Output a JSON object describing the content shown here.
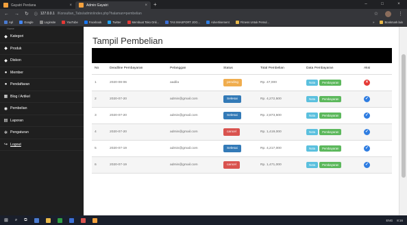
{
  "browser": {
    "tabs": [
      {
        "title": "Gayatri Perdana",
        "active": false,
        "color": "#f4a13d"
      },
      {
        "title": "Admin Gayatri",
        "active": true,
        "color": "#f4a13d"
      }
    ],
    "new_tab": "+",
    "window_controls": {
      "minimize": "–",
      "maximize": "□",
      "close": "×"
    },
    "url_host": "127.0.0.1",
    "url_path": "/Konsultan_Tabs/admin/index.php?halaman=pembelian",
    "bookmarks": [
      "Apl",
      "Google",
      "Loginsite",
      "YouTube",
      "Facebook",
      "Twitter",
      "Membuat Toko Onli...",
      "TAS IMASPORT JOG...",
      "Advertisement",
      "Fitness Untuk Pemul..."
    ],
    "bookmarks_right": [
      "»",
      "Bookmark lain"
    ]
  },
  "sidebar": {
    "top_cut": "Home",
    "items": [
      {
        "label": "Kategori",
        "icon": "tag-icon",
        "glyph": "◆"
      },
      {
        "label": "Produk",
        "icon": "tag-icon",
        "glyph": "◆"
      },
      {
        "label": "Diskon",
        "icon": "tag-icon",
        "glyph": "◆"
      },
      {
        "label": "Member",
        "icon": "user-icon",
        "glyph": "●"
      },
      {
        "label": "Pendaftaran",
        "icon": "user-icon",
        "glyph": "●"
      },
      {
        "label": "Blog / Artikel",
        "icon": "blog-icon",
        "glyph": "▦"
      },
      {
        "label": "Pembelian",
        "icon": "globe-icon",
        "glyph": "◉"
      },
      {
        "label": "Laporan",
        "icon": "print-icon",
        "glyph": "▤"
      },
      {
        "label": "Pengaturan",
        "icon": "gear-icon",
        "glyph": "✲"
      },
      {
        "label": "Logout",
        "icon": "logout-icon",
        "glyph": "↪"
      }
    ]
  },
  "page": {
    "title": "Tampil Pembelian",
    "columns": [
      "No",
      "Deadline Pembayaran",
      "Pelanggan",
      "Status",
      "Total Pembelian",
      "Data Pembayaran",
      "Aksi"
    ],
    "nota_label": "Nota",
    "pembayaran_label": "Pembayaran",
    "rows": [
      {
        "no": "1",
        "deadline": "2020-08-06",
        "pelanggan": "aadila",
        "status": "pending",
        "total": "Rp. 47,000",
        "aksi": "delete"
      },
      {
        "no": "2",
        "deadline": "2020-07-20",
        "pelanggan": "admin@gmail.com",
        "status": "Selesai",
        "total": "Rp. 4,272,500",
        "aksi": "done"
      },
      {
        "no": "3",
        "deadline": "2020-07-20",
        "pelanggan": "admin@gmail.com",
        "status": "Selesai",
        "total": "Rp. 2,873,500",
        "aksi": "done"
      },
      {
        "no": "4",
        "deadline": "2020-07-20",
        "pelanggan": "admin@gmail.com",
        "status": "cancel",
        "total": "Rp. 1,419,000",
        "aksi": "done"
      },
      {
        "no": "5",
        "deadline": "2020-07-19",
        "pelanggan": "admin@gmail.com",
        "status": "Selesai",
        "total": "Rp. 4,217,000",
        "aksi": "done"
      },
      {
        "no": "6",
        "deadline": "2020-07-19",
        "pelanggan": "admin@gmail.com",
        "status": "cancel",
        "total": "Rp. 1,471,000",
        "aksi": "done"
      }
    ]
  },
  "taskbar": {
    "time": "8:16",
    "lang": "ENG"
  },
  "colors": {
    "sidebar_bg": "#1f1f1f",
    "pending": "#f0ad4e",
    "selesai": "#337ab7",
    "cancel": "#d9534f",
    "nota": "#5bc0de",
    "pembayaran": "#5cb85c"
  }
}
